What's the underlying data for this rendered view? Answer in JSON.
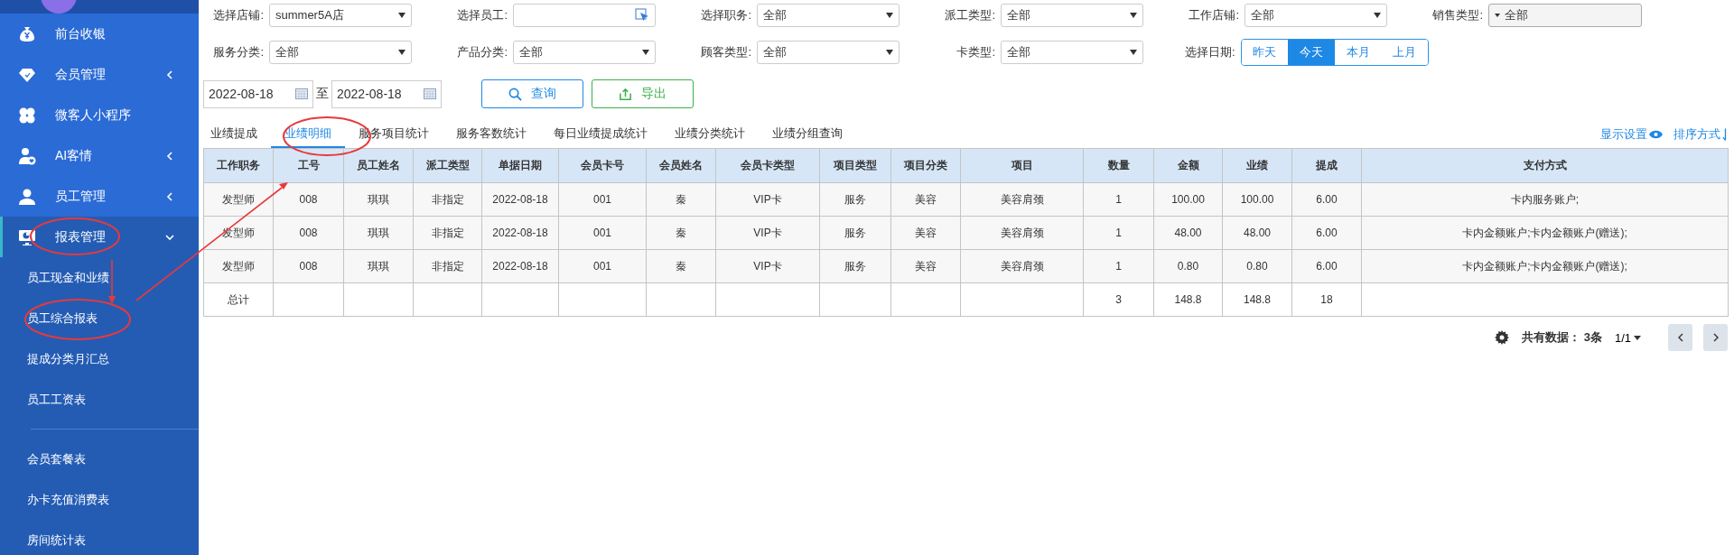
{
  "sidebar": {
    "items": [
      {
        "label": "前台收银",
        "has_submenu": false,
        "expanded": false
      },
      {
        "label": "会员管理",
        "has_submenu": true,
        "expanded": false
      },
      {
        "label": "微客人小程序",
        "has_submenu": false,
        "expanded": false
      },
      {
        "label": "AI客情",
        "has_submenu": true,
        "expanded": false
      },
      {
        "label": "员工管理",
        "has_submenu": true,
        "expanded": false
      },
      {
        "label": "报表管理",
        "has_submenu": true,
        "expanded": true,
        "sections": [
          {
            "children": [
              {
                "label": "员工现金和业绩"
              },
              {
                "label": "员工综合报表"
              },
              {
                "label": "提成分类月汇总"
              },
              {
                "label": "员工工资表"
              }
            ]
          },
          {
            "children": [
              {
                "label": "会员套餐表"
              },
              {
                "label": "办卡充值消费表"
              },
              {
                "label": "房间统计表"
              }
            ]
          }
        ]
      }
    ]
  },
  "filters": [
    {
      "label": "选择店铺:",
      "kind": "select",
      "value": "summer5A店"
    },
    {
      "label": "选择员工:",
      "kind": "picker"
    },
    {
      "label": "选择职务:",
      "kind": "select",
      "value": "全部"
    },
    {
      "label": "派工类型:",
      "kind": "select",
      "value": "全部"
    },
    {
      "label": "工作店铺:",
      "kind": "select",
      "value": "全部"
    },
    {
      "label": "销售类型:",
      "kind": "multiselect",
      "value": "全部"
    },
    {
      "label": "服务分类:",
      "kind": "select",
      "value": "全部"
    },
    {
      "label": "产品分类:",
      "kind": "select",
      "value": "全部"
    },
    {
      "label": "顾客类型:",
      "kind": "select",
      "value": "全部"
    },
    {
      "label": "卡类型:",
      "kind": "select",
      "value": "全部"
    },
    {
      "label": "选择日期:",
      "kind": "segmented",
      "options": [
        {
          "label": "昨天",
          "selected": false
        },
        {
          "label": "今天",
          "selected": true
        },
        {
          "label": "本月",
          "selected": false
        },
        {
          "label": "上月",
          "selected": false
        }
      ]
    }
  ],
  "date_range": {
    "start": "2022-08-18",
    "separator": "至",
    "end": "2022-08-18"
  },
  "actions": [
    {
      "label": "查询",
      "kind": "search"
    },
    {
      "label": "导出",
      "kind": "export"
    }
  ],
  "tabs": [
    {
      "label": "业绩提成",
      "selected": false
    },
    {
      "label": "业绩明细",
      "selected": true
    },
    {
      "label": "服务项目统计",
      "selected": false
    },
    {
      "label": "服务客数统计",
      "selected": false
    },
    {
      "label": "每日业绩提成统计",
      "selected": false
    },
    {
      "label": "业绩分类统计",
      "selected": false
    },
    {
      "label": "业绩分组查询",
      "selected": false
    }
  ],
  "tools": [
    {
      "label": "显示设置",
      "kind": "display"
    },
    {
      "label": "排序方式",
      "kind": "sort"
    }
  ],
  "table": {
    "columns": [
      "工作职务",
      "工号",
      "员工姓名",
      "派工类型",
      "单据日期",
      "会员卡号",
      "会员姓名",
      "会员卡类型",
      "项目类型",
      "项目分类",
      "项目",
      "数量",
      "金额",
      "业绩",
      "提成",
      "支付方式"
    ],
    "rows": [
      [
        "发型师",
        "008",
        "琪琪",
        "非指定",
        "2022-08-18",
        "001",
        "秦",
        "VIP卡",
        "服务",
        "美容",
        "美容肩颈",
        "1",
        "100.00",
        "100.00",
        "6.00",
        "卡内服务账户;"
      ],
      [
        "发型师",
        "008",
        "琪琪",
        "非指定",
        "2022-08-18",
        "001",
        "秦",
        "VIP卡",
        "服务",
        "美容",
        "美容肩颈",
        "1",
        "48.00",
        "48.00",
        "6.00",
        "卡内金额账户;卡内金额账户(赠送);"
      ],
      [
        "发型师",
        "008",
        "琪琪",
        "非指定",
        "2022-08-18",
        "001",
        "秦",
        "VIP卡",
        "服务",
        "美容",
        "美容肩颈",
        "1",
        "0.80",
        "0.80",
        "6.00",
        "卡内金额账户;卡内金额账户(赠送);"
      ]
    ],
    "total": {
      "label": "总计",
      "quantity": "3",
      "amount": "148.8",
      "performance": "148.8",
      "commission": "18"
    }
  },
  "pagination": {
    "label": "共有数据：",
    "count": "3条",
    "pages": "1/1"
  }
}
